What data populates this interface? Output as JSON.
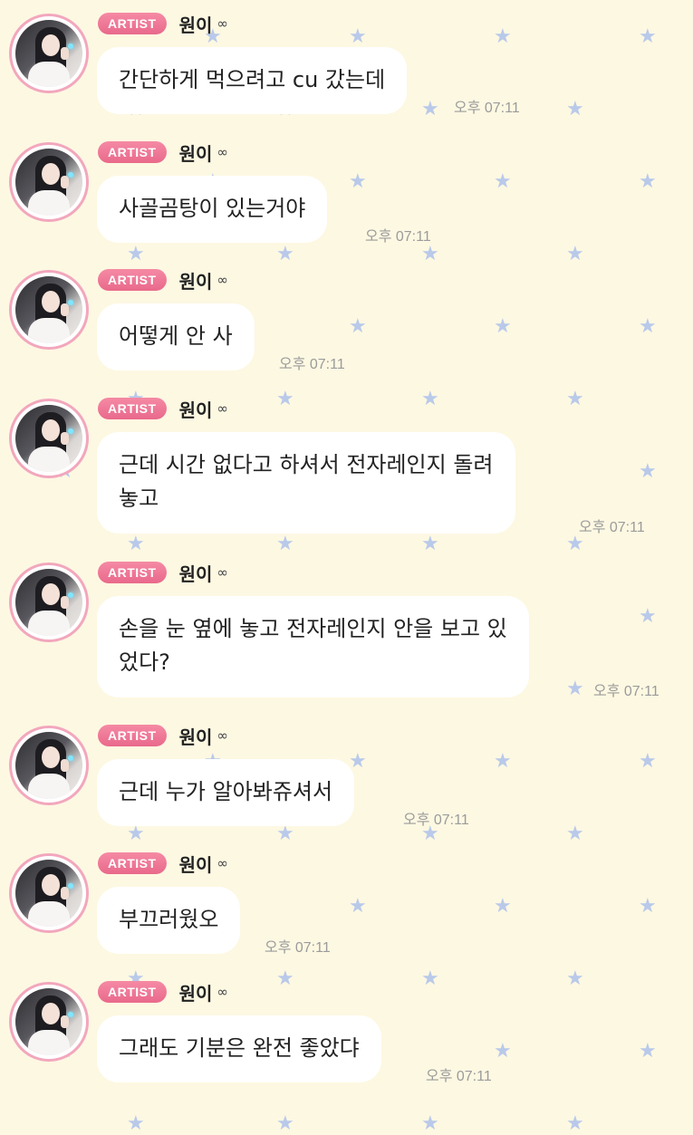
{
  "chat": {
    "messages": [
      {
        "badge": "ARTIST",
        "name": "원이",
        "text": "간단하게 먹으려고 cu 갔는데",
        "time": "오후 07:11"
      },
      {
        "badge": "ARTIST",
        "name": "원이",
        "text": "사골곰탕이 있는거야",
        "time": "오후 07:11"
      },
      {
        "badge": "ARTIST",
        "name": "원이",
        "text": "어떻게 안 사",
        "time": "오후 07:11"
      },
      {
        "badge": "ARTIST",
        "name": "원이",
        "text": "근데 시간 없다고 하셔서 전자레인지 돌려\n놓고",
        "time": "오후 07:11"
      },
      {
        "badge": "ARTIST",
        "name": "원이",
        "text": "손을 눈 옆에 놓고 전자레인지 안을 보고 있\n었다?",
        "time": "오후 07:11"
      },
      {
        "badge": "ARTIST",
        "name": "원이",
        "text": "근데 누가 알아봐쥬셔서",
        "time": "오후 07:11"
      },
      {
        "badge": "ARTIST",
        "name": "원이",
        "text": "부끄러웠오",
        "time": "오후 07:11"
      },
      {
        "badge": "ARTIST",
        "name": "원이",
        "text": "그래도 기분은 완전 좋았댜",
        "time": "오후 07:11"
      }
    ]
  },
  "icons": {
    "avatar": "profile-photo",
    "name_suffix": "infinity-icon",
    "background": "star-pattern"
  },
  "colors": {
    "background": "#fdf8e2",
    "badge": "#ee7896",
    "avatar_ring": "#f2a7bd",
    "star": "#b9c9ea"
  }
}
